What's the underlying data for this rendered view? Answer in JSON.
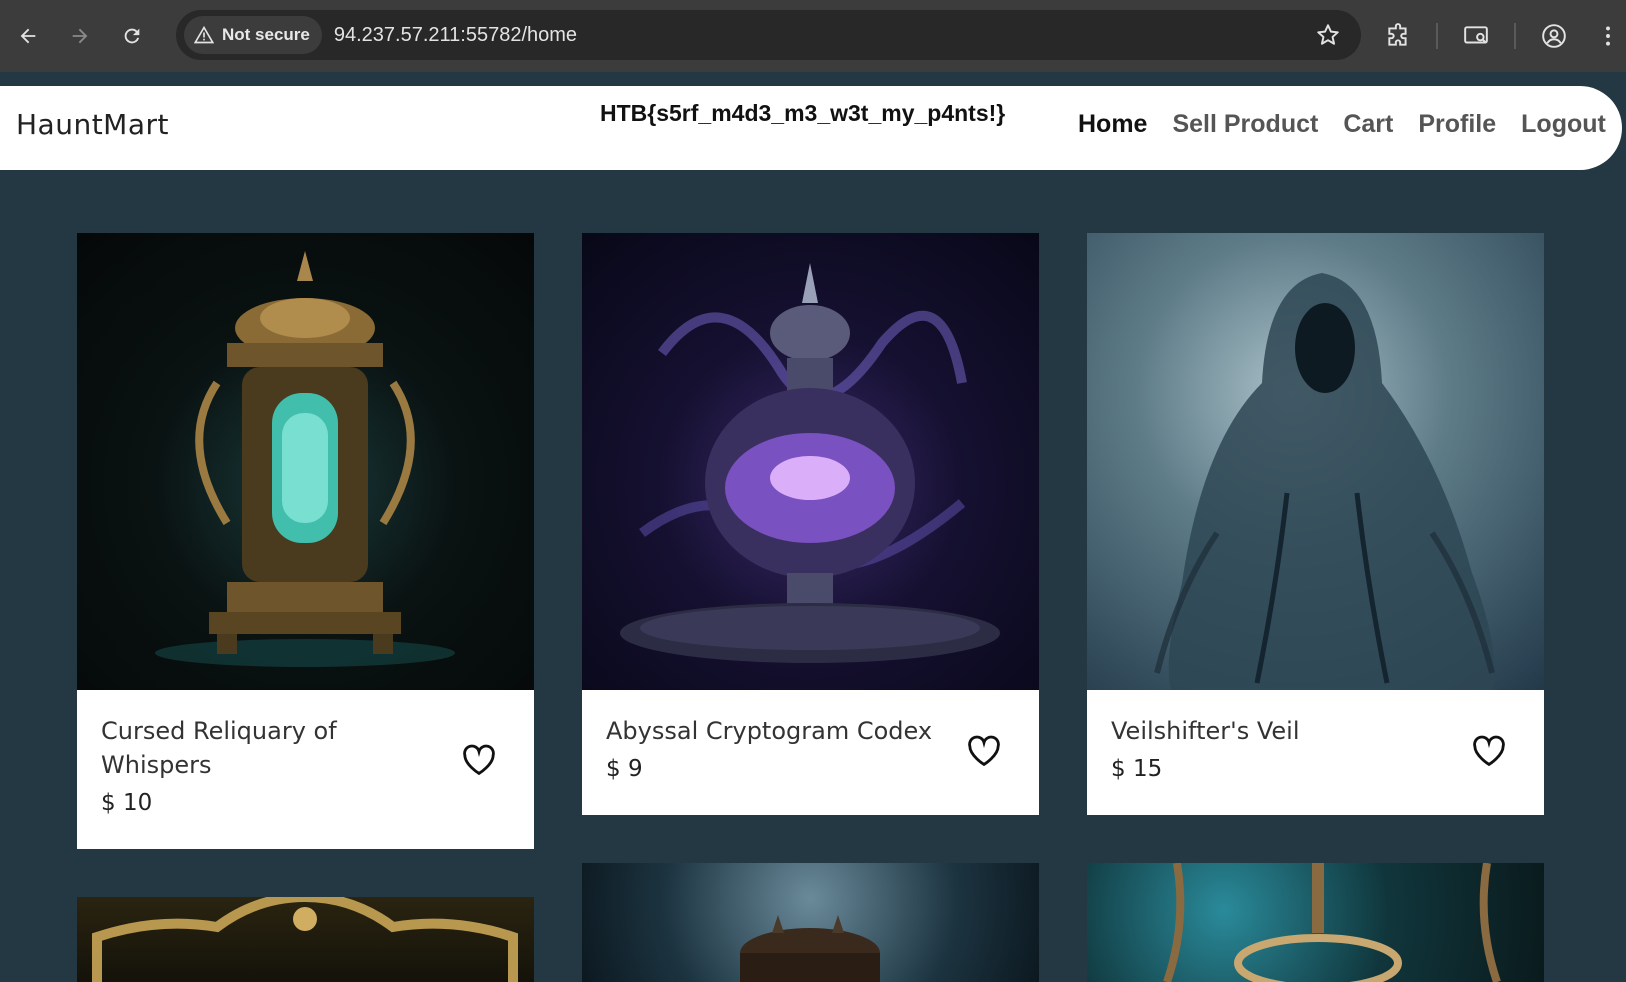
{
  "browser": {
    "security_label": "Not secure",
    "url": "94.237.57.211:55782/home"
  },
  "site": {
    "brand": "HauntMart",
    "flag": "HTB{s5rf_m4d3_m3_w3t_my_p4nts!}",
    "menu": [
      "Home",
      "Sell Product",
      "Cart",
      "Profile",
      "Logout"
    ]
  },
  "products": [
    {
      "name": "Cursed Reliquary of Whispers",
      "price": "$ 10"
    },
    {
      "name": "Abyssal Cryptogram Codex",
      "price": "$ 9"
    },
    {
      "name": "Veilshifter's Veil",
      "price": "$ 15"
    }
  ],
  "icons": {
    "back": "arrow-left-icon",
    "forward": "arrow-right-icon",
    "reload": "reload-icon",
    "warning": "warning-triangle-icon",
    "bookmark": "star-icon",
    "extensions": "puzzle-icon",
    "cast": "cast-icon",
    "profile": "account-icon",
    "menu": "kebab-icon",
    "favorite": "heart-icon"
  },
  "colors": {
    "page_background": "#233842",
    "chrome_background": "#3c3c3c",
    "card_background": "#ffffff"
  }
}
